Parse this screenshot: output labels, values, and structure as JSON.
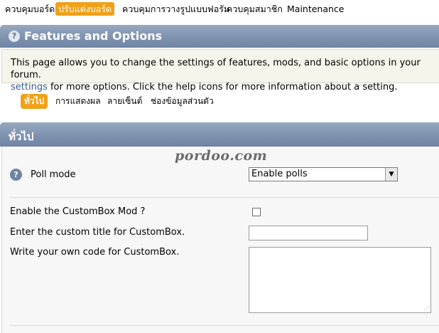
{
  "topnav": {
    "tabs": [
      "ควบคุมบอร์ด",
      "ปรับแต่งบอร์ด",
      "ควบคุมการวางรูปแบบฟอรัม",
      "ควบคุมสมาชิก",
      "Maintenance"
    ],
    "active": "ปรับแต่งบอร์ด"
  },
  "section": {
    "title": "Features and Options",
    "help_glyph": "?",
    "desc_line1": "This page allows you to change the settings of features, mods, and basic options in your forum.",
    "desc_link": "settings",
    "desc_line2_rest": " for more options. Click the help icons for more information about a setting."
  },
  "subtabs": {
    "items": [
      "ทั่วไป",
      "การแสดงผล",
      "ลายเซ็นต์",
      "ช่องข้อมูลส่วนตัว"
    ],
    "active": "ทั่วไป"
  },
  "group": {
    "title": "ทั่วไป",
    "watermark": "pordoo.com"
  },
  "settings": {
    "poll_mode_label": "Poll mode",
    "poll_mode_value": "Enable polls",
    "custombox_enable_label": "Enable the CustomBox Mod ?",
    "custombox_enable_checked": false,
    "custombox_title_label": "Enter the custom title for CustomBox.",
    "custombox_title_value": "",
    "custombox_code_label": "Write your own code for CustomBox.",
    "custombox_code_value": ""
  },
  "icons": {
    "help": "help-icon",
    "dropdown": "chevron-down-icon",
    "resize": "resize-grip-icon"
  },
  "colors": {
    "accent": "#f0a118",
    "header_bar": "#7f93b0",
    "link": "#355b8f"
  }
}
